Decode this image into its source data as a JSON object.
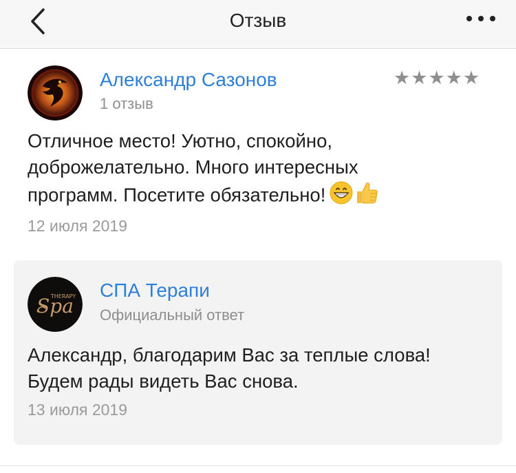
{
  "navbar": {
    "title": "Отзыв",
    "back_icon": "chevron-left-icon",
    "more_icon": "more-dots-icon"
  },
  "review": {
    "author_name": "Александр Сазонов",
    "review_count": "1 отзыв",
    "rating": 5,
    "rating_max": 5,
    "text_lines": [
      "Отличное место! Уютно, спокойно,",
      "доброжелательно. Много интересных",
      "программ. Посетите обязательно!"
    ],
    "emojis": [
      "grinning-face-icon",
      "thumbs-up-icon"
    ],
    "date": "12 июля 2019"
  },
  "reply": {
    "company_name": "СПА Терапи",
    "label": "Официальный ответ",
    "logo_text": "Spa",
    "logo_subtext": "THERAPY",
    "text_lines": [
      "Александр, благодарим Вас за теплые слова!",
      "Будем рады видеть Вас снова."
    ],
    "date": "13 июля 2019"
  },
  "colors": {
    "link_blue": "#2e7fd9",
    "star_gray": "#8f8f8f",
    "reply_background": "#f3f3f3"
  }
}
